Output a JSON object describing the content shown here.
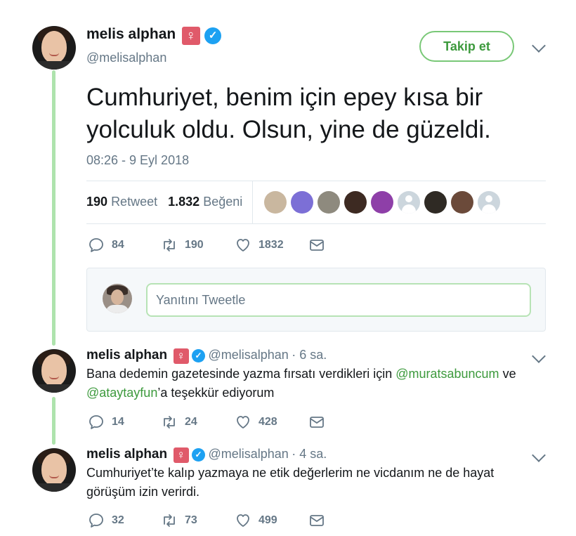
{
  "main_tweet": {
    "name": "melis alphan",
    "handle": "@melisalphan",
    "venus_symbol": "♀",
    "verified_mark": "✓",
    "follow_label": "Takip et",
    "text": "Cumhuriyet, benim için epey kısa bir yolculuk oldu. Olsun, yine de güzeldi.",
    "timestamp": "08:26 - 9 Eyl 2018",
    "retweet_count": "190",
    "retweet_label": "Retweet",
    "like_count": "1.832",
    "like_label": "Beğeni",
    "likers": [
      {
        "color": "#c9b79f"
      },
      {
        "color": "#7c6fd6"
      },
      {
        "color": "#8e8a7e"
      },
      {
        "color": "#3d2a22"
      },
      {
        "color": "#8e3fa8"
      },
      {
        "color": "gray"
      },
      {
        "color": "#2f2a24"
      },
      {
        "color": "#6b4a3a"
      },
      {
        "color": "gray"
      }
    ],
    "actions": {
      "replies": "84",
      "retweets": "190",
      "likes": "1832"
    }
  },
  "reply_box": {
    "placeholder": "Yanıtını Tweetle"
  },
  "replies": [
    {
      "name": "melis alphan",
      "handle": "@melisalphan",
      "time": "· 6 sa.",
      "text_before": "Bana dedemin gazetesinde yazma fırsatı verdikleri için ",
      "mention1": "@muratsabuncum",
      "text_middle": " ve ",
      "mention2": "@ataytayfun",
      "text_after": "’a teşekkür ediyorum",
      "actions": {
        "replies": "14",
        "retweets": "24",
        "likes": "428"
      }
    },
    {
      "name": "melis alphan",
      "handle": "@melisalphan",
      "time": "· 4 sa.",
      "text": "Cumhuriyet’te kalıp yazmaya ne etik değerlerim ne vicdanım ne de hayat görüşüm izin verirdi.",
      "actions": {
        "replies": "32",
        "retweets": "73",
        "likes": "499"
      }
    }
  ],
  "icons": [
    "reply-icon",
    "retweet-icon",
    "like-icon",
    "direct-message-icon",
    "chevron-down-icon",
    "verified-icon",
    "venus-icon"
  ],
  "colors": {
    "accent": "#3d9a3d",
    "thread": "#aee3ad",
    "verified": "#1da1f2",
    "muted": "#657786",
    "venus": "#e05a6a"
  }
}
